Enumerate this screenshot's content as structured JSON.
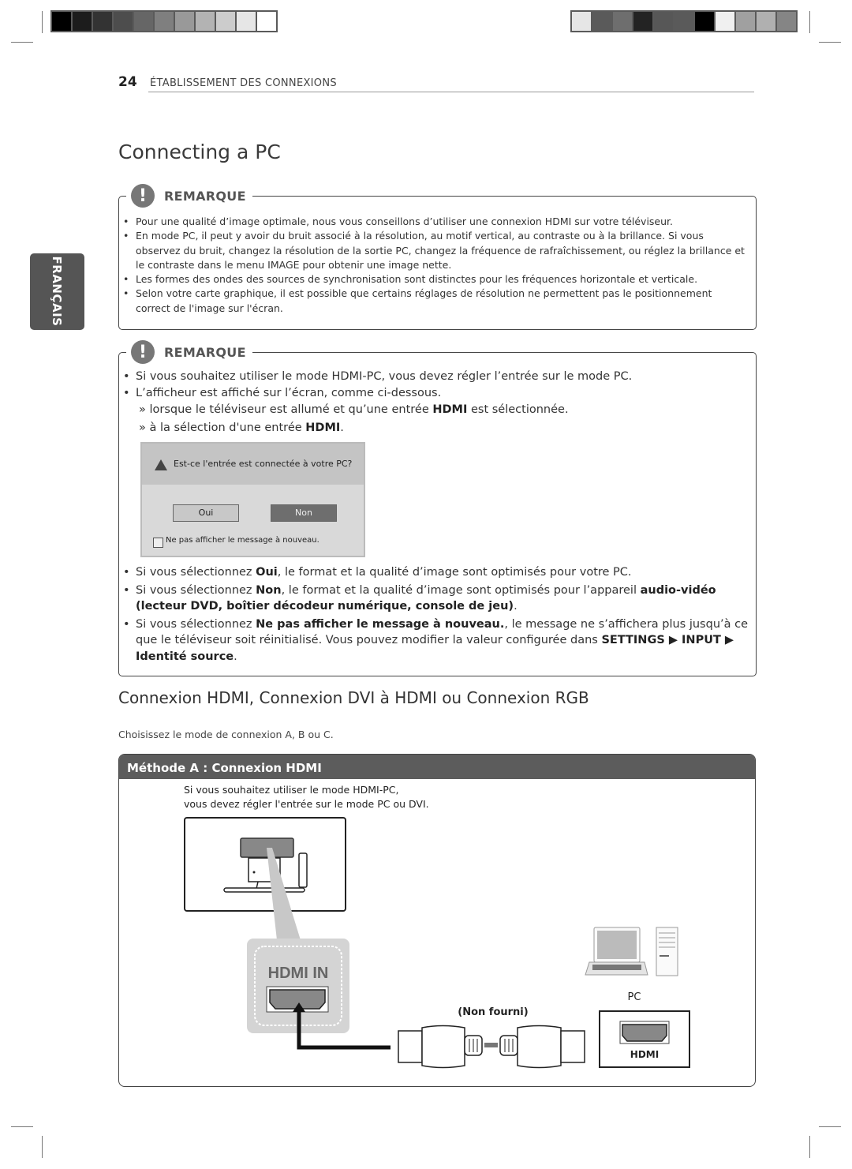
{
  "header": {
    "page_number": "24",
    "section": "ÉTABLISSEMENT DES CONNEXIONS",
    "title": "Connecting a PC"
  },
  "side_tab": {
    "label": "FRANÇAIS"
  },
  "color_bars": {
    "left": [
      "#000000",
      "#1c1c1c",
      "#333333",
      "#4d4d4d",
      "#666666",
      "#7f7f7f",
      "#999999",
      "#b3b3b3",
      "#cccccc",
      "#e6e6e6",
      "#ffffff"
    ],
    "right": [
      "#e6e6e6",
      "#5a5a5a",
      "#6e6e6e",
      "#232323",
      "#575757",
      "#5a5a5a",
      "#000000",
      "#f0f0f0",
      "#a0a0a0",
      "#b0b0b0",
      "#858585"
    ]
  },
  "note1": {
    "label": "REMARQUE",
    "items": [
      "Pour une qualité d’image optimale, nous vous conseillons d’utiliser une connexion HDMI sur votre téléviseur.",
      "En mode PC, il peut y avoir du bruit associé à la résolution, au motif vertical, au contraste ou à la brillance. Si vous observez du bruit, changez la résolution de la sortie PC, changez la fréquence de rafraîchissement, ou réglez la brillance et le contraste dans le menu IMAGE pour obtenir une image nette.",
      "Les formes des ondes des sources de synchronisation sont distinctes pour les fréquences horizontale et verticale.",
      "Selon votre carte graphique, il est possible que certains réglages de résolution ne permettent pas le positionnement correct de l'image sur l'écran."
    ]
  },
  "note2": {
    "label": "REMARQUE",
    "item1": "Si vous souhaitez utiliser le mode HDMI-PC, vous devez régler l’entrée sur le mode PC.",
    "item2": "L’afficheur est affiché sur l’écran, comme ci-dessous.",
    "sub1_pre": "» lorsque le téléviseur est allumé et qu’une entrée ",
    "sub1_bold": "HDMI",
    "sub1_post": " est sélectionnée.",
    "sub2_pre": "» à la sélection d'une entrée ",
    "sub2_bold": "HDMI",
    "sub2_post": ".",
    "dialog": {
      "message": "Est-ce l'entrée est connectée à votre PC?",
      "yes": "Oui",
      "no": "Non",
      "checkbox": "Ne pas afficher le message à nouveau."
    },
    "item3_pre": "Si vous sélectionnez ",
    "item3_bold": "Oui",
    "item3_post": ", le format et la qualité d’image sont optimisés pour votre PC.",
    "item4_pre": "Si vous sélectionnez ",
    "item4_bold": "Non",
    "item4_mid": ", le format et la qualité d’image sont optimisés pour l’appareil ",
    "item4_bold2": "audio-vidéo (lecteur DVD, boîtier décodeur numérique, console de jeu)",
    "item4_post": ".",
    "item5_pre": "Si vous sélectionnez ",
    "item5_bold": "Ne pas afficher le message à nouveau.",
    "item5_mid": ", le message ne s’affichera plus jusqu’à ce que le téléviseur soit réinitialisé. Vous pouvez modifier la valeur configurée dans ",
    "item5_bold2": "SETTINGS ▶ INPUT ▶ Identité source",
    "item5_post": "."
  },
  "section2": {
    "title": "Connexion HDMI, Connexion DVI à HDMI ou Connexion RGB",
    "intro": "Choisissez le mode de connexion A, B ou C.",
    "method_title": "Méthode A : Connexion HDMI",
    "method_line1": "Si vous souhaitez utiliser le mode HDMI-PC,",
    "method_line2": "vous devez régler l'entrée sur le mode PC ou DVI.",
    "diagram": {
      "hdmi_in_label": "HDMI IN",
      "cable_label": "(Non fourni)",
      "pc_label": "PC",
      "pc_port_label": "HDMI"
    }
  }
}
